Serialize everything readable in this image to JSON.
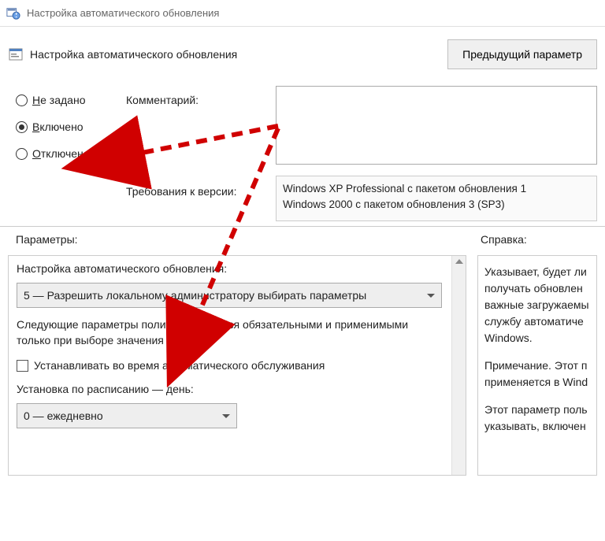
{
  "window_title": "Настройка автоматического обновления",
  "header": {
    "policy_name": "Настройка автоматического обновления",
    "prev_button": "Предыдущий параметр"
  },
  "radios": {
    "not_configured": "Не задано",
    "enabled": "Включено",
    "disabled": "Отключено",
    "selected": "enabled"
  },
  "labels": {
    "comment": "Комментарий:",
    "requirements": "Требования к версии:",
    "parameters": "Параметры:",
    "help": "Справка:"
  },
  "requirements_text": "Windows XP Professional с пакетом обновления 1\nWindows 2000 с пакетом обновления 3 (SP3)",
  "params": {
    "title": "Настройка автоматического обновления:",
    "mode_selected": "5 — Разрешить локальному администратору выбирать параметры",
    "note": "Следующие параметры политики являются обязательными и применимыми только при выборе значения 4.",
    "checkbox_label": "Устанавливать во время автоматического обслуживания",
    "schedule_label": "Установка по расписанию — день:",
    "schedule_selected": "0 — ежедневно"
  },
  "help": {
    "p1": "Указывает, будет ли получать обновлен важные загружаемы службу автоматиче Windows.",
    "p2": "Примечание. Этот п применяется в Wind",
    "p3": "Этот параметр поль указывать, включен"
  }
}
